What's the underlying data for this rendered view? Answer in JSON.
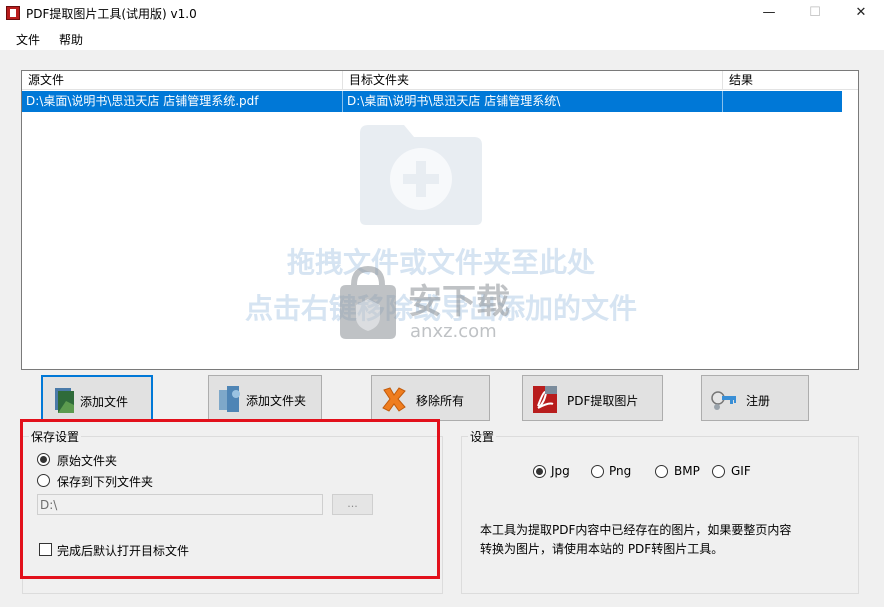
{
  "window": {
    "title": "PDF提取图片工具(试用版) v1.0",
    "min": "—",
    "max": "☐",
    "close": "✕"
  },
  "menu": [
    "文件",
    "帮助"
  ],
  "list": {
    "columns": [
      "源文件",
      "目标文件夹",
      "结果"
    ],
    "rows": [
      {
        "source": "D:\\桌面\\说明书\\思迅天店 店铺管理系统.pdf",
        "target": "D:\\桌面\\说明书\\思迅天店 店铺管理系统\\",
        "result": ""
      }
    ],
    "drop_hint_1": "拖拽文件或文件夹至此处",
    "drop_hint_2": "点击右键移除或导出添加的文件",
    "watermark_text": "安下载",
    "watermark_sub": "anxz.com"
  },
  "toolbar": {
    "add_file": "添加文件",
    "add_folder": "添加文件夹",
    "remove_all": "移除所有",
    "extract": "PDF提取图片",
    "register": "注册"
  },
  "save_settings": {
    "title": "保存设置",
    "option_original": "原始文件夹",
    "option_custom": "保存到下列文件夹",
    "selected": "original",
    "path_value": "D:\\",
    "browse_label": "...",
    "open_after": "完成后默认打开目标文件",
    "open_after_checked": false
  },
  "settings": {
    "title": "设置",
    "formats": [
      "Jpg",
      "Png",
      "BMP",
      "GIF"
    ],
    "selected_format": "Jpg",
    "info_line1": "本工具为提取PDF内容中已经存在的图片，如果要整页内容",
    "info_line2": "转换为图片，请使用本站的 PDF转图片工具。"
  },
  "colors": {
    "selection": "#0078d7",
    "highlight": "#e2101b",
    "accent": "#0078d7"
  }
}
